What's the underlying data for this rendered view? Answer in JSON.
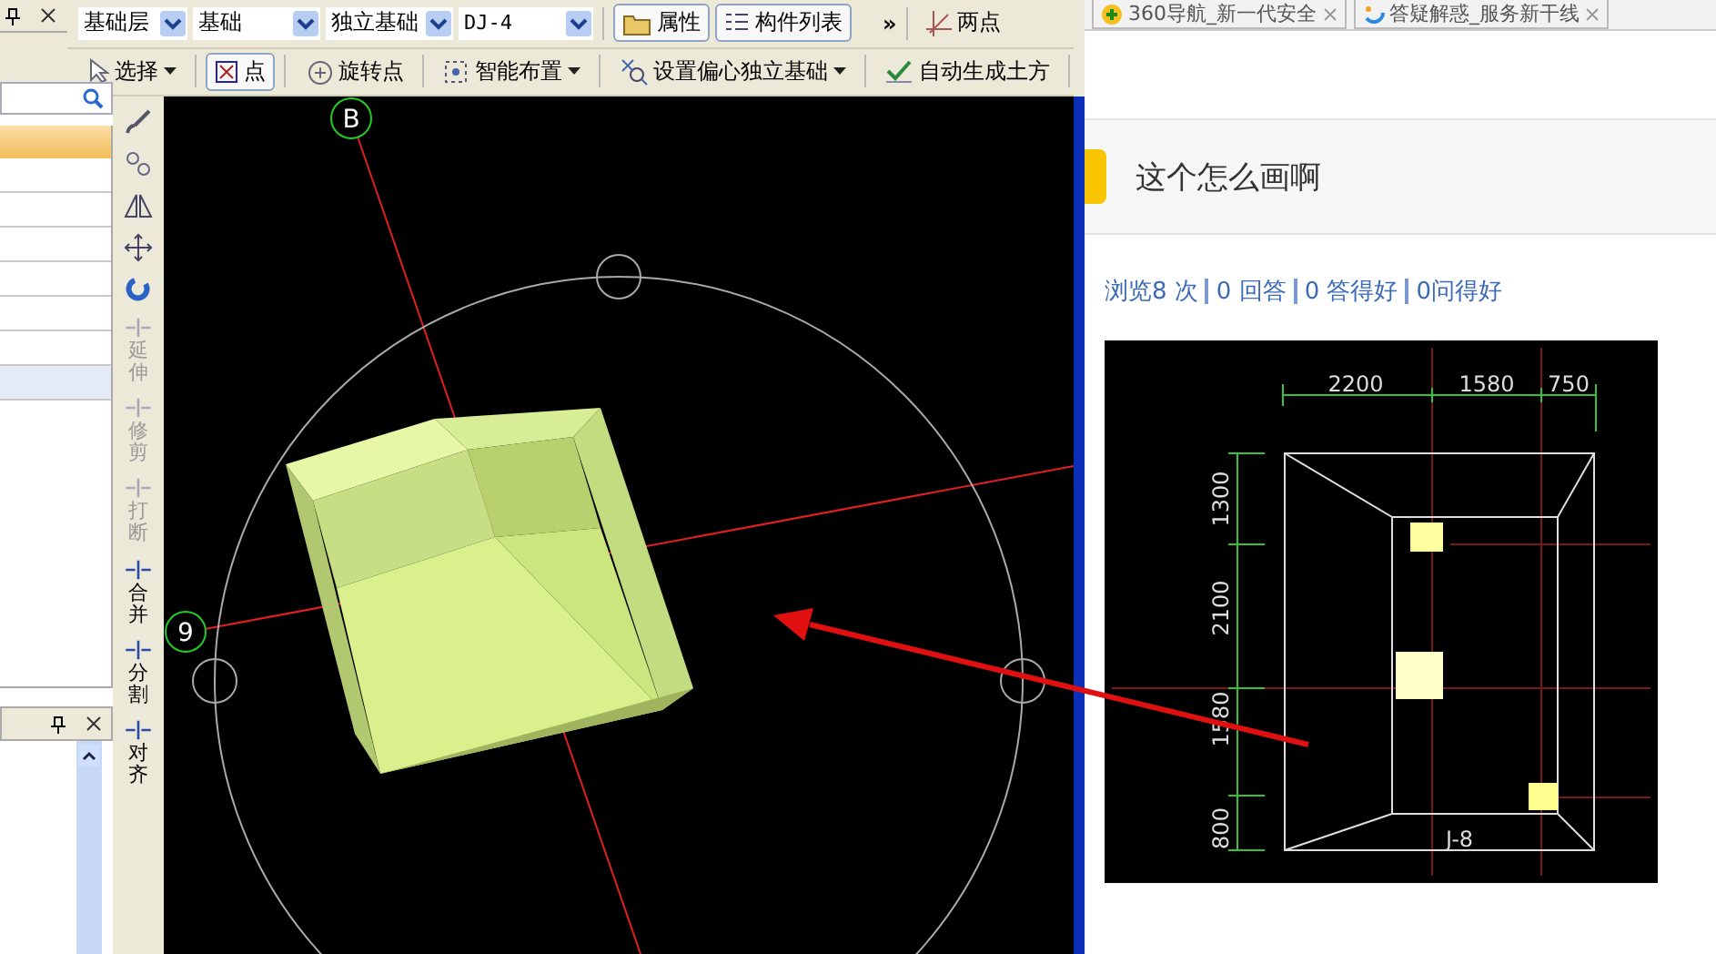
{
  "toolbar_top": {
    "dropdowns": [
      {
        "value": "基础层"
      },
      {
        "value": "基础"
      },
      {
        "value": "独立基础"
      },
      {
        "value": "DJ-4"
      }
    ],
    "buttons": [
      {
        "label": "属性",
        "kind": "properties"
      },
      {
        "label": "构件列表",
        "kind": "list"
      }
    ],
    "overflow": "»",
    "two_point": "两点"
  },
  "toolbar_draw": [
    {
      "label": "选择",
      "kind": "select",
      "dropdown": true,
      "selected": false
    },
    {
      "label": "点",
      "kind": "point",
      "dropdown": false,
      "selected": true
    },
    {
      "label": "旋转点",
      "kind": "rotate",
      "dropdown": false,
      "selected": false
    },
    {
      "label": "智能布置",
      "kind": "smart",
      "dropdown": true,
      "selected": false
    },
    {
      "label": "设置偏心独立基础",
      "kind": "offset",
      "dropdown": true,
      "selected": false
    },
    {
      "label": "自动生成土方",
      "kind": "earth",
      "dropdown": false,
      "selected": false
    }
  ],
  "left_panel": {
    "rows": [
      {
        "selected": false
      },
      {
        "selected": false
      },
      {
        "selected": false
      },
      {
        "selected": false
      },
      {
        "selected": false
      },
      {
        "selected": false
      },
      {
        "selected": true
      }
    ]
  },
  "side_tools": [
    {
      "kind": "brush"
    },
    {
      "kind": "copy"
    },
    {
      "kind": "mirror"
    },
    {
      "kind": "move"
    },
    {
      "kind": "rotate"
    },
    {
      "kind": "extend",
      "label": "延伸",
      "disabled": true
    },
    {
      "kind": "trim",
      "label": "修剪",
      "disabled": true
    },
    {
      "kind": "break",
      "label": "打断",
      "disabled": true
    },
    {
      "kind": "merge",
      "label": "合并",
      "disabled": false
    },
    {
      "kind": "split",
      "label": "分割",
      "disabled": false
    },
    {
      "kind": "align",
      "label": "对齐",
      "disabled": false
    }
  ],
  "canvas": {
    "axis_labels": [
      "B",
      "9"
    ]
  },
  "browser": {
    "tabs": [
      {
        "label": "360导航_新一代安全",
        "kind": "nav"
      },
      {
        "label": "答疑解惑_服务新干线",
        "kind": "qa"
      }
    ],
    "question_title": "这个怎么画啊",
    "stats": [
      "浏览8 次",
      "0 回答",
      "0 答得好",
      "0问得好"
    ],
    "figure": {
      "top_dims": [
        "2200",
        "1580",
        "750"
      ],
      "side_dims": [
        "1300",
        "2100",
        "1580",
        "800"
      ],
      "label": "J-8"
    }
  }
}
